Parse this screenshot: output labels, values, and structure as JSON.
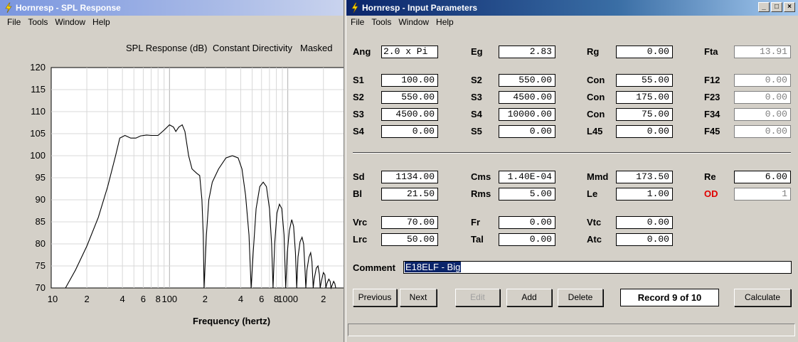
{
  "spl_window": {
    "title": "Hornresp - SPL Response",
    "menu": [
      "File",
      "Tools",
      "Window",
      "Help"
    ],
    "header": [
      "SPL Response (dB)",
      "Constant Directivity",
      "Masked"
    ]
  },
  "chart_data": {
    "type": "line",
    "title": "SPL Response (dB)",
    "xlabel": "Frequency (hertz)",
    "ylabel": "",
    "x_scale": "log",
    "xlim": [
      10,
      3000
    ],
    "ylim": [
      70,
      120
    ],
    "grid": true,
    "y_ticks": [
      "120",
      "115",
      "110",
      "105",
      "100",
      "95",
      "90",
      "85",
      "80",
      "75",
      "70"
    ],
    "x_ticks": [
      {
        "value": 10,
        "label": "10"
      },
      {
        "value": 20,
        "label": "2"
      },
      {
        "value": 40,
        "label": "4"
      },
      {
        "value": 60,
        "label": "6"
      },
      {
        "value": 80,
        "label": "8"
      },
      {
        "value": 100,
        "label": "100"
      },
      {
        "value": 200,
        "label": "2"
      },
      {
        "value": 400,
        "label": "4"
      },
      {
        "value": 600,
        "label": "6"
      },
      {
        "value": 800,
        "label": "8"
      },
      {
        "value": 1000,
        "label": "1000"
      },
      {
        "value": 2000,
        "label": "2"
      }
    ],
    "series": [
      {
        "color": "#000000",
        "points": [
          [
            13.2,
            70
          ],
          [
            16,
            74
          ],
          [
            20,
            79.5
          ],
          [
            25,
            86
          ],
          [
            30,
            93
          ],
          [
            35,
            100
          ],
          [
            38,
            104
          ],
          [
            42,
            104.6
          ],
          [
            47,
            104
          ],
          [
            52,
            104
          ],
          [
            57,
            104.5
          ],
          [
            64,
            104.7
          ],
          [
            70,
            104.6
          ],
          [
            80,
            104.6
          ],
          [
            90,
            105.8
          ],
          [
            100,
            107
          ],
          [
            108,
            106.5
          ],
          [
            113,
            105.5
          ],
          [
            120,
            106.5
          ],
          [
            128,
            107
          ],
          [
            135,
            105.5
          ],
          [
            145,
            100
          ],
          [
            155,
            97
          ],
          [
            170,
            96
          ],
          [
            180,
            95.5
          ],
          [
            188,
            90
          ],
          [
            193,
            82
          ],
          [
            196,
            70
          ],
          [
            205,
            82
          ],
          [
            215,
            90
          ],
          [
            230,
            94
          ],
          [
            260,
            97
          ],
          [
            300,
            99.5
          ],
          [
            340,
            100
          ],
          [
            380,
            99.5
          ],
          [
            410,
            97
          ],
          [
            440,
            91
          ],
          [
            470,
            82
          ],
          [
            490,
            70
          ],
          [
            510,
            78
          ],
          [
            540,
            88
          ],
          [
            580,
            93
          ],
          [
            620,
            94
          ],
          [
            660,
            93
          ],
          [
            700,
            88
          ],
          [
            730,
            80
          ],
          [
            750,
            70
          ],
          [
            775,
            80
          ],
          [
            810,
            87
          ],
          [
            850,
            89
          ],
          [
            890,
            88
          ],
          [
            930,
            82
          ],
          [
            960,
            70
          ],
          [
            990,
            78
          ],
          [
            1030,
            83
          ],
          [
            1080,
            85.5
          ],
          [
            1120,
            84
          ],
          [
            1160,
            78
          ],
          [
            1190,
            70
          ],
          [
            1220,
            77
          ],
          [
            1270,
            80.5
          ],
          [
            1320,
            81.5
          ],
          [
            1360,
            80
          ],
          [
            1400,
            74
          ],
          [
            1420,
            70
          ],
          [
            1450,
            74
          ],
          [
            1510,
            77
          ],
          [
            1560,
            78
          ],
          [
            1600,
            76
          ],
          [
            1640,
            70
          ],
          [
            1670,
            72
          ],
          [
            1740,
            74.5
          ],
          [
            1800,
            75
          ],
          [
            1850,
            73
          ],
          [
            1880,
            70
          ],
          [
            1920,
            71.5
          ],
          [
            2000,
            73.5
          ],
          [
            2060,
            73
          ],
          [
            2100,
            70
          ],
          [
            2140,
            71
          ],
          [
            2220,
            72
          ],
          [
            2280,
            71.5
          ],
          [
            2320,
            70
          ],
          [
            2360,
            70.5
          ],
          [
            2440,
            71.5
          ],
          [
            2500,
            71
          ],
          [
            2540,
            70
          ]
        ]
      }
    ]
  },
  "input_window": {
    "title": "Hornresp - Input Parameters",
    "menu": [
      "File",
      "Tools",
      "Window",
      "Help"
    ],
    "params": [
      {
        "label": "Ang",
        "value": "2.0 x Pi",
        "red": false,
        "disabled": false
      },
      {
        "label": "Eg",
        "value": "2.83",
        "red": false,
        "disabled": false
      },
      {
        "label": "Rg",
        "value": "0.00",
        "red": false,
        "disabled": false
      },
      {
        "label": "Fta",
        "value": "13.91",
        "red": false,
        "disabled": true
      },
      {
        "label": "S1",
        "value": "100.00",
        "red": false,
        "disabled": false
      },
      {
        "label": "S2",
        "value": "550.00",
        "red": false,
        "disabled": false
      },
      {
        "label": "Con",
        "value": "55.00",
        "red": false,
        "disabled": false
      },
      {
        "label": "F12",
        "value": "0.00",
        "red": false,
        "disabled": true
      },
      {
        "label": "S2",
        "value": "550.00",
        "red": false,
        "disabled": false
      },
      {
        "label": "S3",
        "value": "4500.00",
        "red": false,
        "disabled": false
      },
      {
        "label": "Con",
        "value": "175.00",
        "red": false,
        "disabled": false
      },
      {
        "label": "F23",
        "value": "0.00",
        "red": false,
        "disabled": true
      },
      {
        "label": "S3",
        "value": "4500.00",
        "red": false,
        "disabled": false
      },
      {
        "label": "S4",
        "value": "10000.00",
        "red": false,
        "disabled": false
      },
      {
        "label": "Con",
        "value": "75.00",
        "red": false,
        "disabled": false
      },
      {
        "label": "F34",
        "value": "0.00",
        "red": false,
        "disabled": true
      },
      {
        "label": "S4",
        "value": "0.00",
        "red": false,
        "disabled": false
      },
      {
        "label": "S5",
        "value": "0.00",
        "red": false,
        "disabled": false
      },
      {
        "label": "L45",
        "value": "0.00",
        "red": false,
        "disabled": false
      },
      {
        "label": "F45",
        "value": "0.00",
        "red": false,
        "disabled": true
      },
      {
        "label": "Sd",
        "value": "1134.00",
        "red": false,
        "disabled": false
      },
      {
        "label": "Cms",
        "value": "1.40E-04",
        "red": false,
        "disabled": false
      },
      {
        "label": "Mmd",
        "value": "173.50",
        "red": false,
        "disabled": false
      },
      {
        "label": "Re",
        "value": "6.00",
        "red": false,
        "disabled": false
      },
      {
        "label": "Bl",
        "value": "21.50",
        "red": false,
        "disabled": false
      },
      {
        "label": "Rms",
        "value": "5.00",
        "red": false,
        "disabled": false
      },
      {
        "label": "Le",
        "value": "1.00",
        "red": false,
        "disabled": false
      },
      {
        "label": "OD",
        "value": "1",
        "red": true,
        "disabled": true
      },
      {
        "label": "Vrc",
        "value": "70.00",
        "red": false,
        "disabled": false
      },
      {
        "label": "Fr",
        "value": "0.00",
        "red": false,
        "disabled": false
      },
      {
        "label": "Vtc",
        "value": "0.00",
        "red": false,
        "disabled": false
      },
      {
        "label": "Lrc",
        "value": "50.00",
        "red": false,
        "disabled": false
      },
      {
        "label": "Tal",
        "value": "0.00",
        "red": false,
        "disabled": false
      },
      {
        "label": "Atc",
        "value": "0.00",
        "red": false,
        "disabled": false
      }
    ],
    "comment_label": "Comment",
    "comment_value": "E18ELF - Big",
    "buttons": {
      "previous": "Previous",
      "next": "Next",
      "edit": "Edit",
      "add": "Add",
      "delete": "Delete",
      "calculate": "Calculate"
    },
    "record": "Record 9 of 10"
  },
  "colors": {
    "od_label": "#e00000",
    "selection": "#0a246a"
  }
}
